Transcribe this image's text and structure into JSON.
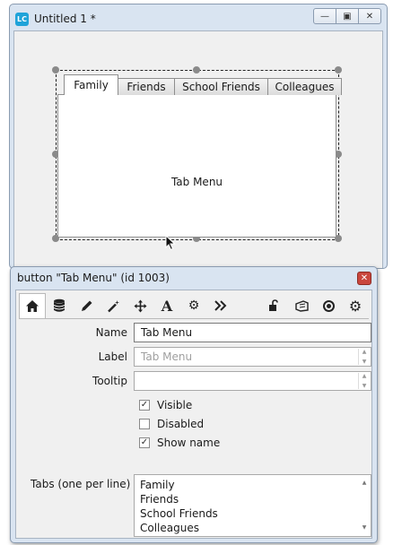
{
  "main_window": {
    "title": "Untitled 1 *",
    "logo_text": "LC",
    "controls": {
      "minimize": "—",
      "restore": "▣",
      "close": "✕"
    },
    "tabs": [
      {
        "label": "Family",
        "active": true
      },
      {
        "label": "Friends",
        "active": false
      },
      {
        "label": "School Friends",
        "active": false
      },
      {
        "label": "Colleagues",
        "active": false
      }
    ],
    "panel_label": "Tab Menu"
  },
  "inspector": {
    "title": "button \"Tab Menu\" (id 1003)",
    "close": "✕",
    "toolbar": [
      "home-icon",
      "database-icon",
      "pencil-icon",
      "magic-wand-icon",
      "move-arrows-icon",
      "text-icon",
      "gears-icon",
      "forward-icon",
      "lock-icon",
      "message-icon",
      "target-icon",
      "gear-icon"
    ],
    "fields": {
      "name_label": "Name",
      "name_value": "Tab Menu",
      "label_label": "Label",
      "label_placeholder": "Tab Menu",
      "tooltip_label": "Tooltip",
      "tooltip_value": ""
    },
    "checkboxes": [
      {
        "label": "Visible",
        "checked": true
      },
      {
        "label": "Disabled",
        "checked": false
      },
      {
        "label": "Show name",
        "checked": true
      }
    ],
    "tabs_field": {
      "label": "Tabs (one per line)",
      "lines": [
        "Family",
        "Friends",
        "School Friends",
        "Colleagues"
      ]
    }
  }
}
